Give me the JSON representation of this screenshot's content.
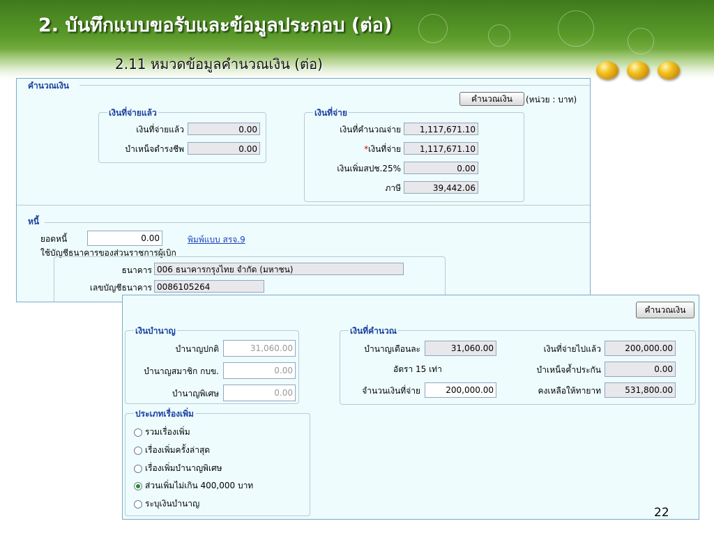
{
  "slide": {
    "title": "2. บันทึกแบบขอรับและข้อมูลประกอบ (ต่อ)",
    "subtitle": "2.11 หมวดข้อมูลคำนวณเงิน (ต่อ)",
    "page_number": "22"
  },
  "calc_panel": {
    "legend": "คำนวณเงิน",
    "calc_button": "คำนวณเงิน",
    "unit": "(หน่วย : บาท)",
    "paid": {
      "legend": "เงินที่จ่ายแล้ว",
      "paid_label": "เงินที่จ่ายแล้ว",
      "paid_value": "0.00",
      "pension_remain_label": "บำเหน็จดำรงชีพ",
      "pension_remain_value": "0.00"
    },
    "payment": {
      "legend": "เงินที่จ่าย",
      "calc_label": "เงินที่คำนวณจ่าย",
      "calc_value": "1,117,671.10",
      "pay_label": "เงินที่จ่าย",
      "pay_mark": "*",
      "pay_value": "1,117,671.10",
      "extra_label": "เงินเพิ่มสปช.25%",
      "extra_value": "0.00",
      "tax_label": "ภาษี",
      "tax_value": "39,442.06"
    },
    "debt": {
      "legend": "หนี้",
      "amount_label": "ยอดหนี้",
      "amount_value": "0.00",
      "print_link": "พิมพ์แบบ สรจ.9",
      "bank_note": "ใช้บัญชีธนาคารของส่วนราชการผู้เบิก",
      "bank_label": "ธนาคาร",
      "bank_value": "006 ธนาคารกรุงไทย จำกัด (มหาชน)",
      "account_label": "เลขบัญชีธนาคาร",
      "account_value": "0086105264"
    }
  },
  "pension_panel": {
    "calc_button": "คำนวณเงิน",
    "pension": {
      "legend": "เงินบำนาญ",
      "normal_label": "บำนาญปกติ",
      "normal_value": "31,060.00",
      "member_label": "บำนาญสมาชิก กบข.",
      "member_value": "0.00",
      "special_label": "บำนาญพิเศษ",
      "special_value": "0.00"
    },
    "computed": {
      "legend": "เงินที่คำนวณ",
      "monthly_label": "บำนาญเดือนละ",
      "monthly_value": "31,060.00",
      "rate_text": "อัตรา 15 เท่า",
      "amount_label": "จำนวนเงินที่จ่าย",
      "amount_value": "200,000.00",
      "paid_label": "เงินที่จ่ายไปแล้ว",
      "paid_value": "200,000.00",
      "guarantee_label": "บำเหน็จค้ำประกัน",
      "guarantee_value": "0.00",
      "heir_label": "คงเหลือให้ทายาท",
      "heir_value": "531,800.00"
    },
    "type": {
      "legend": "ประเภทเรื่องเพิ่ม",
      "options": [
        {
          "label": "รวมเรื่องเพิ่ม",
          "selected": false
        },
        {
          "label": "เรื่องเพิ่มครั้งล่าสุด",
          "selected": false
        },
        {
          "label": "เรื่องเพิ่มบำนาญพิเศษ",
          "selected": false
        },
        {
          "label": "ส่วนเพิ่มไม่เกิน 400,000 บาท",
          "selected": true
        },
        {
          "label": "ระบุเงินบำนาญ",
          "selected": false
        }
      ]
    }
  }
}
